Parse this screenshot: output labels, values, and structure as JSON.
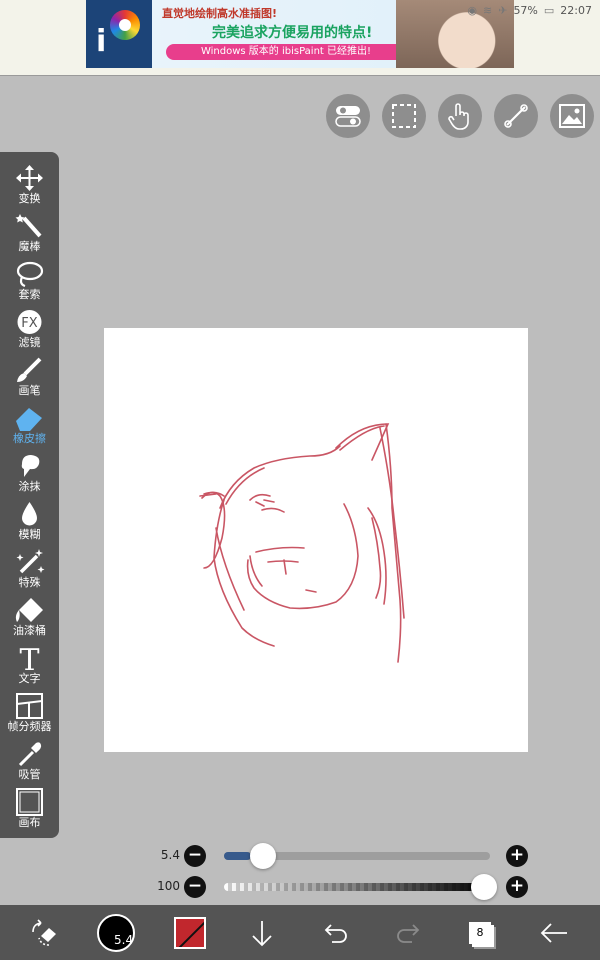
{
  "status_bar": {
    "battery": "57%",
    "time": "22:07"
  },
  "ad": {
    "line1": "直觉地绘制高水准插图!",
    "line2": "完美追求方便易用的特点!",
    "line3": "Windows 版本的 ibisPaint 已经推出!"
  },
  "top_buttons": [
    {
      "name": "toggle-icon"
    },
    {
      "name": "selection-icon"
    },
    {
      "name": "touch-icon"
    },
    {
      "name": "ruler-icon"
    },
    {
      "name": "image-icon"
    }
  ],
  "toolbar": {
    "tools": [
      {
        "label": "变换",
        "icon": "move-icon"
      },
      {
        "label": "魔棒",
        "icon": "magic-wand-icon"
      },
      {
        "label": "套索",
        "icon": "lasso-icon"
      },
      {
        "label": "滤镜",
        "icon": "fx-icon",
        "glyph_text": "FX"
      },
      {
        "label": "画笔",
        "icon": "brush-icon"
      },
      {
        "label": "橡皮擦",
        "icon": "eraser-icon",
        "active": true
      },
      {
        "label": "涂抹",
        "icon": "smudge-icon"
      },
      {
        "label": "模糊",
        "icon": "blur-icon"
      },
      {
        "label": "特殊",
        "icon": "special-icon"
      },
      {
        "label": "油漆桶",
        "icon": "paint-bucket-icon"
      },
      {
        "label": "文字",
        "icon": "text-icon",
        "glyph_text": "T"
      },
      {
        "label": "帧分频器",
        "icon": "frame-divider-icon"
      },
      {
        "label": "吸管",
        "icon": "eyedropper-icon"
      },
      {
        "label": "画布",
        "icon": "canvas-icon"
      }
    ]
  },
  "sliders": {
    "size": {
      "value": "5.4",
      "fraction": 0.1
    },
    "opacity": {
      "value": "100",
      "fraction": 1.0
    }
  },
  "bottom_bar": {
    "brush_size": "5.4",
    "color": "#c1272d",
    "layer_count": "8"
  },
  "colors": {
    "accent_active": "#5fb3f0",
    "stroke": "#c0394a"
  }
}
